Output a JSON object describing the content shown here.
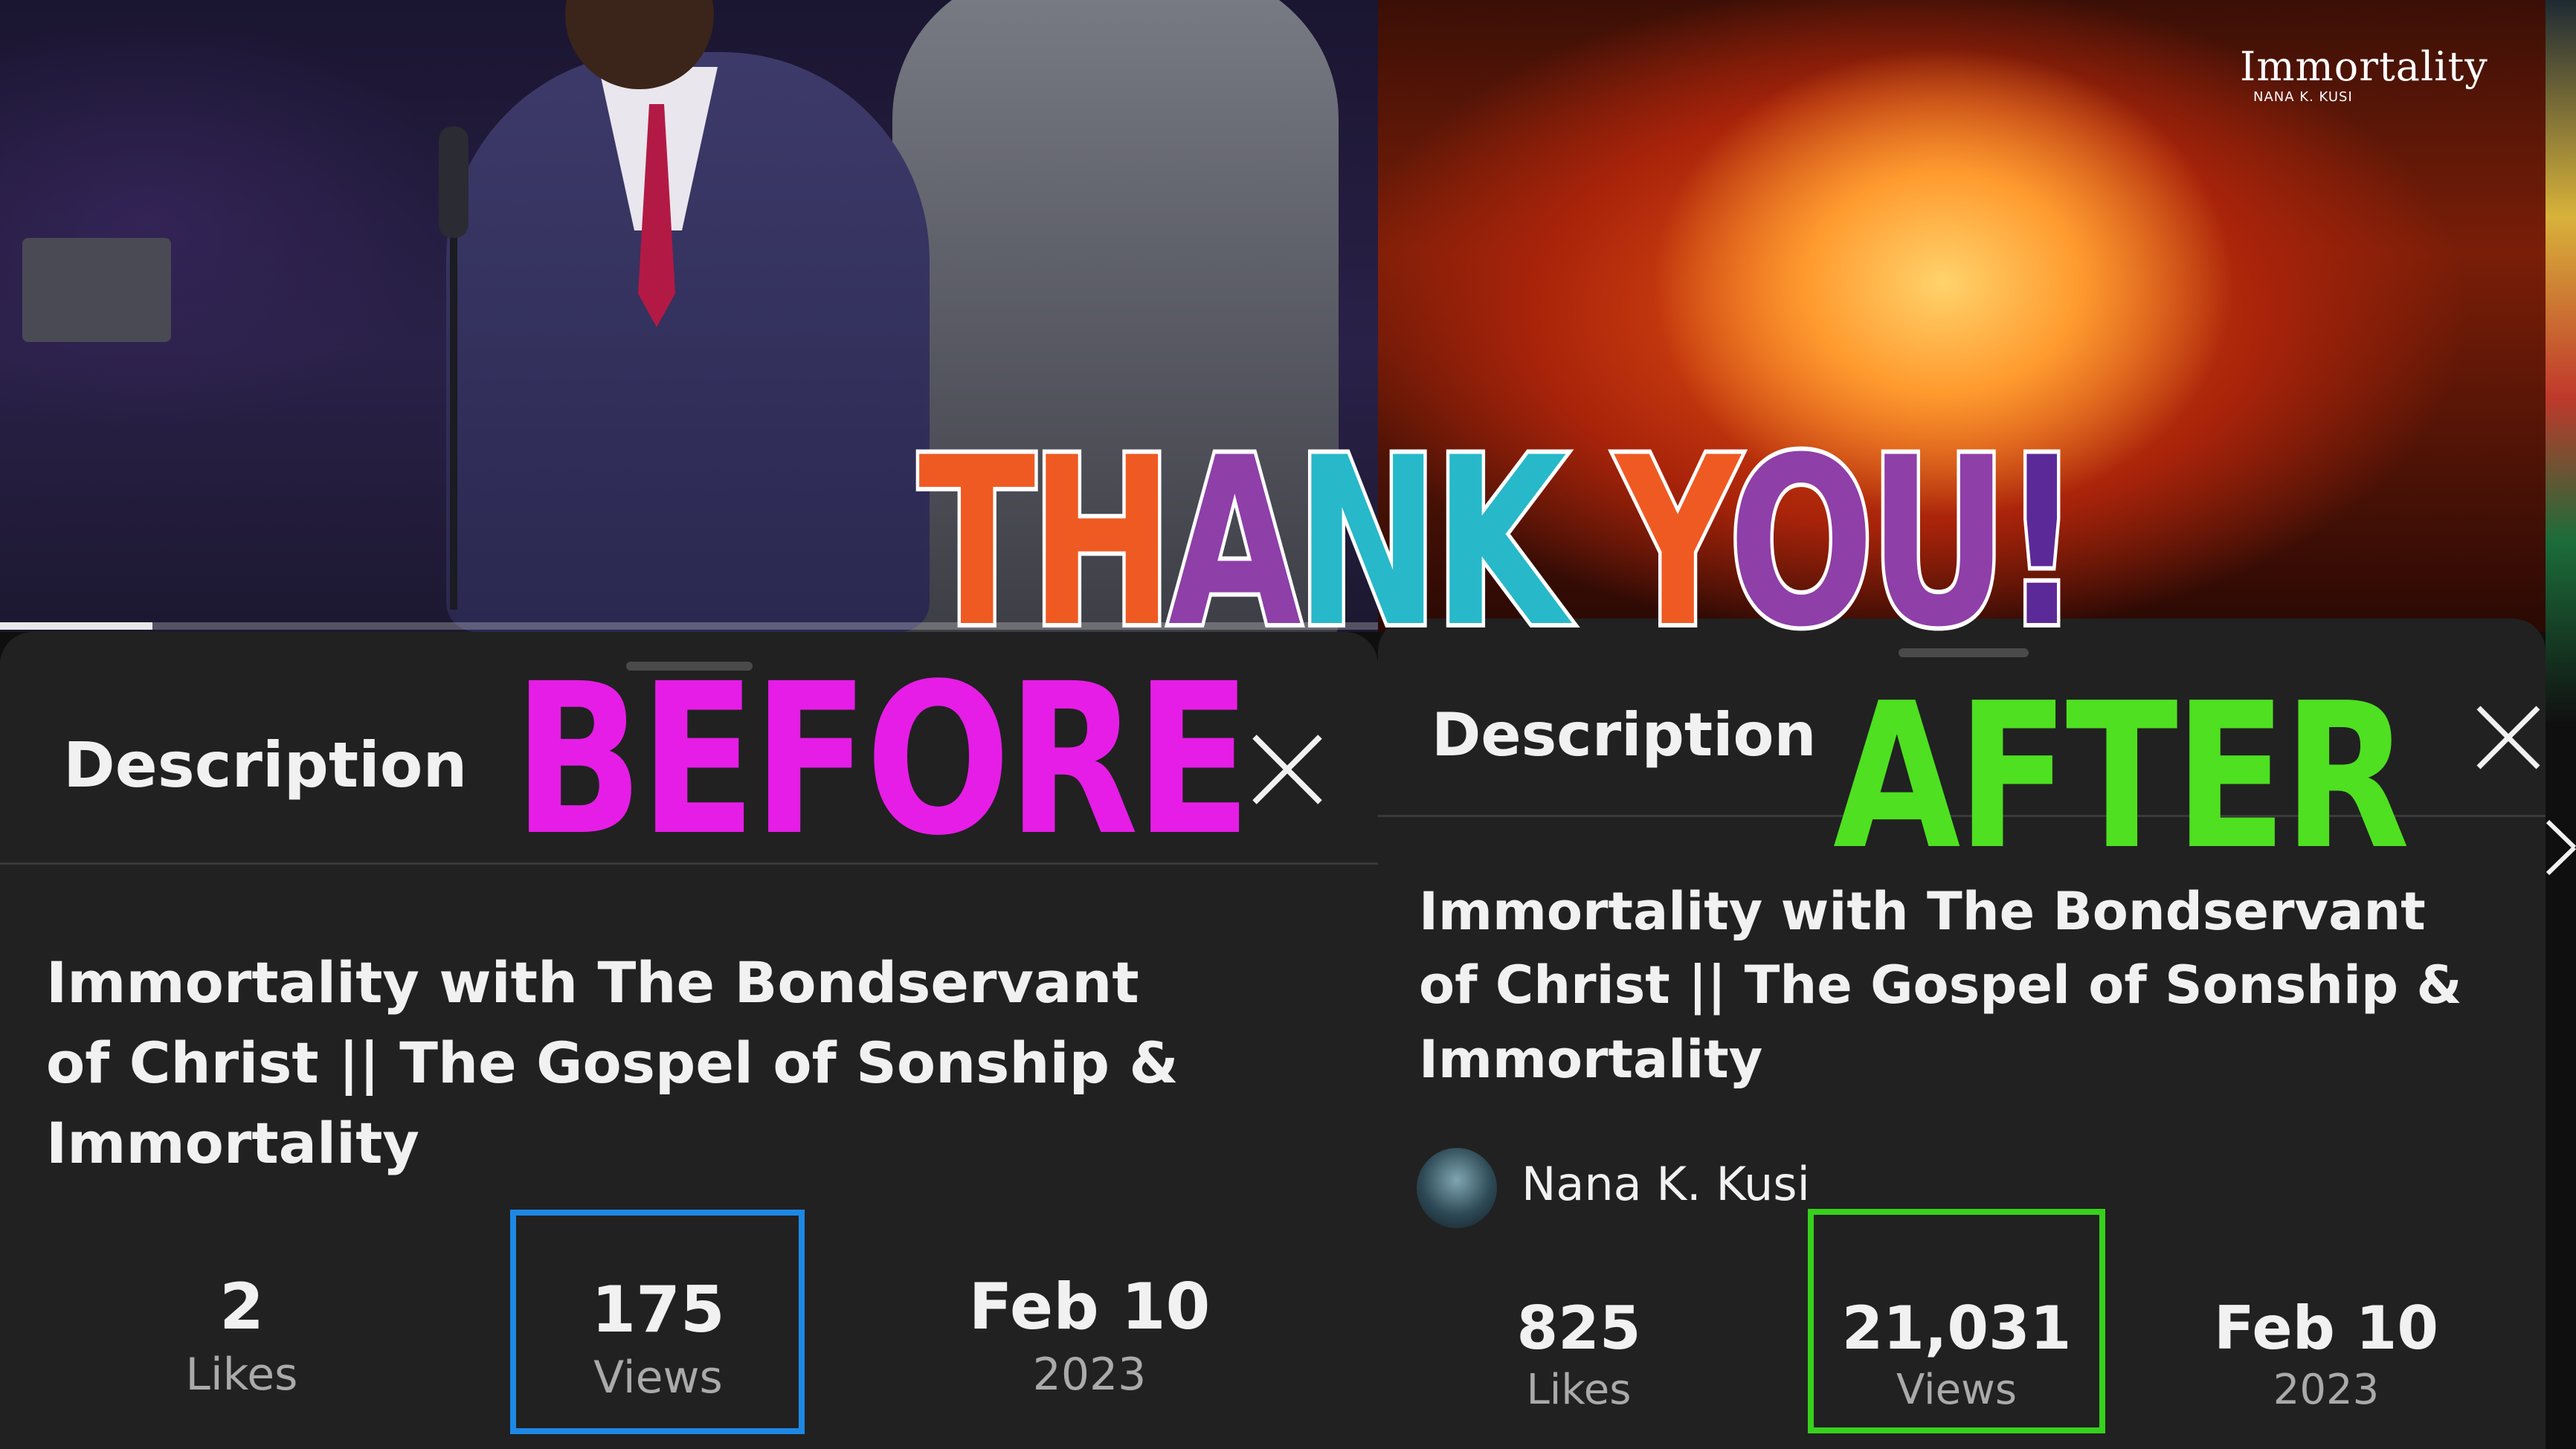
{
  "overlay": {
    "thank_you_parts": [
      "TH",
      "A",
      "NK ",
      "Y",
      "OU",
      "!"
    ],
    "thank_you_colors": [
      "#ef5a23",
      "#8e3fa8",
      "#27b8c9",
      "#ef5a23",
      "#8e3fa8",
      "#5b2a98"
    ],
    "before_label": "BEFORE",
    "before_color": "#e61de6",
    "after_label": "AFTER",
    "after_color": "#4ee021"
  },
  "right_video": {
    "watermark_title": "Immortality",
    "watermark_subtitle": "NANA K. KUSI"
  },
  "before": {
    "heading": "Description",
    "title_lines": [
      "Immortality with The Bondservant",
      "of Christ || The Gospel of Sonship &",
      "Immortality"
    ],
    "stats": [
      {
        "value": "2",
        "label": "Likes"
      },
      {
        "value": "175",
        "label": "Views"
      },
      {
        "value": "Feb 10",
        "label": "2023"
      }
    ],
    "highlight_color": "#1e88e5"
  },
  "after": {
    "heading": "Description",
    "title_lines": [
      "Immortality with The Bondservant",
      "of Christ || The Gospel of Sonship &",
      "Immortality"
    ],
    "channel_name": "Nana K. Kusi",
    "stats": [
      {
        "value": "825",
        "label": "Likes"
      },
      {
        "value": "21,031",
        "label": "Views"
      },
      {
        "value": "Feb 10",
        "label": "2023"
      }
    ],
    "highlight_color": "#36d11c"
  }
}
